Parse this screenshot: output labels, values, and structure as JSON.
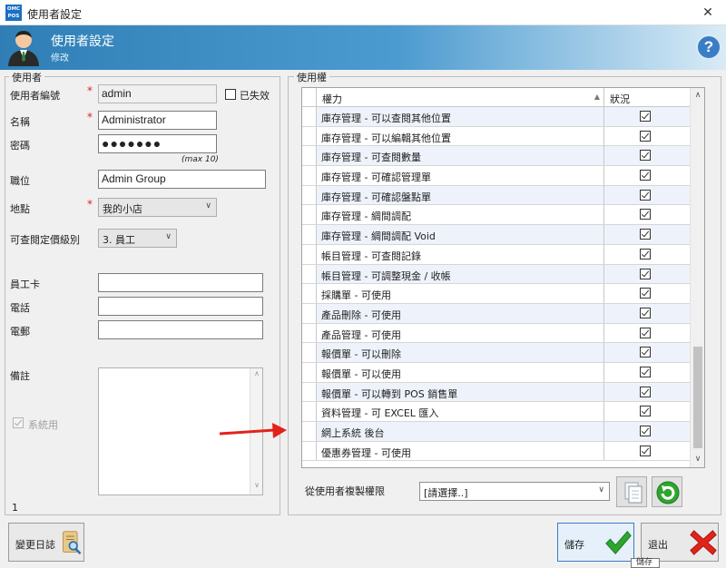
{
  "window": {
    "logo_top": "OMC",
    "logo_bottom": "POS",
    "title": "使用者設定",
    "close_glyph": "✕"
  },
  "header": {
    "title": "使用者設定",
    "subtitle": "修改",
    "help_glyph": "?"
  },
  "user_group": {
    "label": "使用者",
    "user_id_label": "使用者編號",
    "user_id_value": "admin",
    "disabled_label": "已失效",
    "name_label": "名稱",
    "name_value": "Administrator",
    "password_label": "密碼",
    "password_value": "●●●●●●●",
    "password_hint": "(max 10)",
    "position_label": "職位",
    "position_value": "Admin Group",
    "location_label": "地點",
    "location_value": "我的小店",
    "price_level_label": "可查閱定價級別",
    "price_level_value": "3. 員工",
    "staff_card_label": "員工卡",
    "staff_card_value": "",
    "phone_label": "電話",
    "phone_value": "",
    "email_label": "電郵",
    "email_value": "",
    "remarks_label": "備註",
    "system_label": "系統用",
    "record_count": "1"
  },
  "perm_group": {
    "label": "使用權",
    "col_permission": "權力",
    "col_status": "狀況",
    "rows": [
      {
        "name": "庫存管理 - 可以查閱其他位置",
        "checked": true
      },
      {
        "name": "庫存管理 - 可以編輯其他位置",
        "checked": true
      },
      {
        "name": "庫存管理 - 可查閱數量",
        "checked": true
      },
      {
        "name": "庫存管理 - 可確認管理單",
        "checked": true
      },
      {
        "name": "庫存管理 - 可確認盤點單",
        "checked": true
      },
      {
        "name": "庫存管理 - 綢間調配",
        "checked": true
      },
      {
        "name": "庫存管理 - 綢間調配 Void",
        "checked": true
      },
      {
        "name": "帳目管理 - 可查閱記錄",
        "checked": true
      },
      {
        "name": "帳目管理 - 可調整現金 / 收帳",
        "checked": true
      },
      {
        "name": "採購單 - 可使用",
        "checked": true
      },
      {
        "name": "產品刪除 - 可使用",
        "checked": true
      },
      {
        "name": "產品管理 - 可使用",
        "checked": true
      },
      {
        "name": "報價單 - 可以刪除",
        "checked": true
      },
      {
        "name": "報價單 - 可以使用",
        "checked": true
      },
      {
        "name": "報價單 - 可以轉到 POS 銷售單",
        "checked": true
      },
      {
        "name": "資料管理 - 可 EXCEL 匯入",
        "checked": true
      },
      {
        "name": "網上系統 後台",
        "checked": true
      },
      {
        "name": "優惠券管理 - 可使用",
        "checked": true
      }
    ],
    "copy_label": "從使用者複製權限",
    "copy_select_value": "[請選擇..]"
  },
  "buttons": {
    "changelog": "變更日誌",
    "save": "儲存",
    "exit": "退出",
    "save_tooltip": "儲存"
  },
  "colors": {
    "banner": "#2f7fb6",
    "accent_red": "#e2231a",
    "check_green": "#2fa52f"
  }
}
